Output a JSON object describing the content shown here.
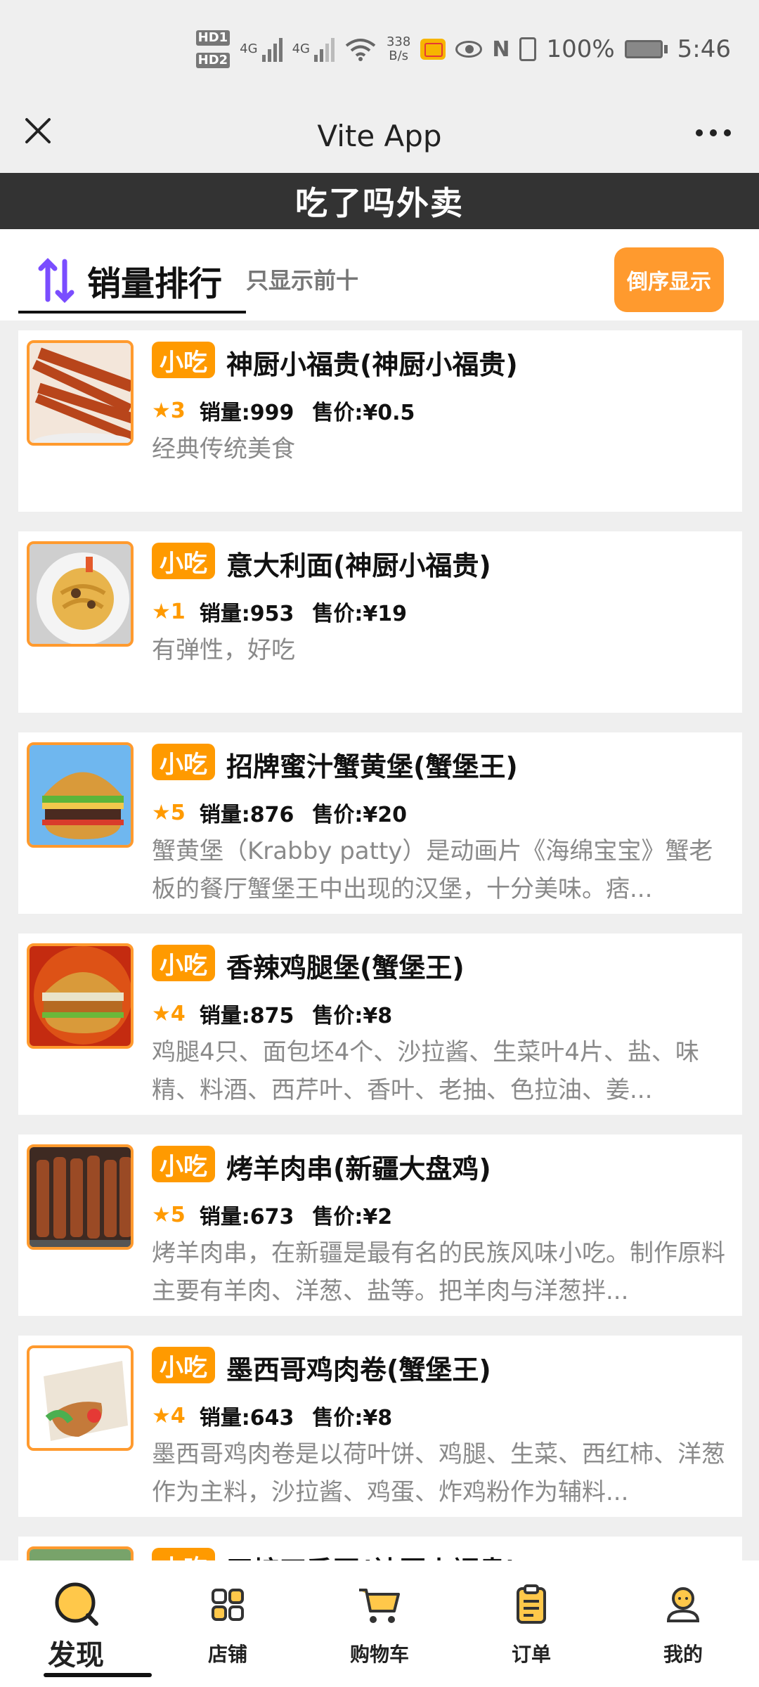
{
  "status_bar": {
    "hd1": "HD1",
    "hd2": "HD2",
    "net1": "4G",
    "net2": "4G",
    "speed_value": "338",
    "speed_unit": "B/s",
    "battery_percent": "100%",
    "time": "5:46"
  },
  "app_bar": {
    "title": "Vite App"
  },
  "banner": {
    "title": "吃了吗外卖"
  },
  "ranking": {
    "title": "销量排行",
    "subtitle": "只显示前十",
    "reverse_button": "倒序显示"
  },
  "items": [
    {
      "tag": "小吃",
      "name": "神厨小福贵(神厨小福贵)",
      "rating": "★3",
      "sales": "销量:999",
      "price": "售价:¥0.5",
      "description": "经典传统美食",
      "image": "fried-dough-sticks"
    },
    {
      "tag": "小吃",
      "name": "意大利面(神厨小福贵)",
      "rating": "★1",
      "sales": "销量:953",
      "price": "售价:¥19",
      "description": "有弹性，好吃",
      "image": "pasta"
    },
    {
      "tag": "小吃",
      "name": "招牌蜜汁蟹黄堡(蟹堡王)",
      "rating": "★5",
      "sales": "销量:876",
      "price": "售价:¥20",
      "description": "蟹黄堡（Krabby patty）是动画片《海绵宝宝》蟹老板的餐厅蟹堡王中出现的汉堡，十分美味。痞...",
      "image": "krabby-patty"
    },
    {
      "tag": "小吃",
      "name": "香辣鸡腿堡(蟹堡王)",
      "rating": "★4",
      "sales": "销量:875",
      "price": "售价:¥8",
      "description": "鸡腿4只、面包坯4个、沙拉酱、生菜叶4片、盐、味精、料酒、西芹叶、香叶、老抽、色拉油、姜...",
      "image": "chicken-burger"
    },
    {
      "tag": "小吃",
      "name": "烤羊肉串(新疆大盘鸡)",
      "rating": "★5",
      "sales": "销量:673",
      "price": "售价:¥2",
      "description": "烤羊肉串，在新疆是最有名的民族风味小吃。制作原料主要有羊肉、洋葱、盐等。把羊肉与洋葱拌...",
      "image": "lamb-skewers"
    },
    {
      "tag": "小吃",
      "name": "墨西哥鸡肉卷(蟹堡王)",
      "rating": "★4",
      "sales": "销量:643",
      "price": "售价:¥8",
      "description": "墨西哥鸡肉卷是以荷叶饼、鸡腿、生菜、西红柿、洋葱作为主料，沙拉酱、鸡蛋、炸鸡粉作为辅料...",
      "image": "chicken-wrap"
    },
    {
      "tag": "小吃",
      "name": "干煸四季豆(神厨小福贵)",
      "rating": "",
      "sales": "",
      "price": "",
      "description": "",
      "image": "partial-item"
    }
  ],
  "bottom_nav": [
    {
      "label": "发现",
      "icon": "discover-icon",
      "active": true
    },
    {
      "label": "店铺",
      "icon": "shop-icon",
      "active": false
    },
    {
      "label": "购物车",
      "icon": "cart-icon",
      "active": false
    },
    {
      "label": "订单",
      "icon": "order-icon",
      "active": false
    },
    {
      "label": "我的",
      "icon": "profile-icon",
      "active": false
    }
  ],
  "colors": {
    "accent": "#ff9a00",
    "button": "#ff9a2e",
    "banner_bg": "#333333",
    "muted_text": "#8a8a8a"
  }
}
